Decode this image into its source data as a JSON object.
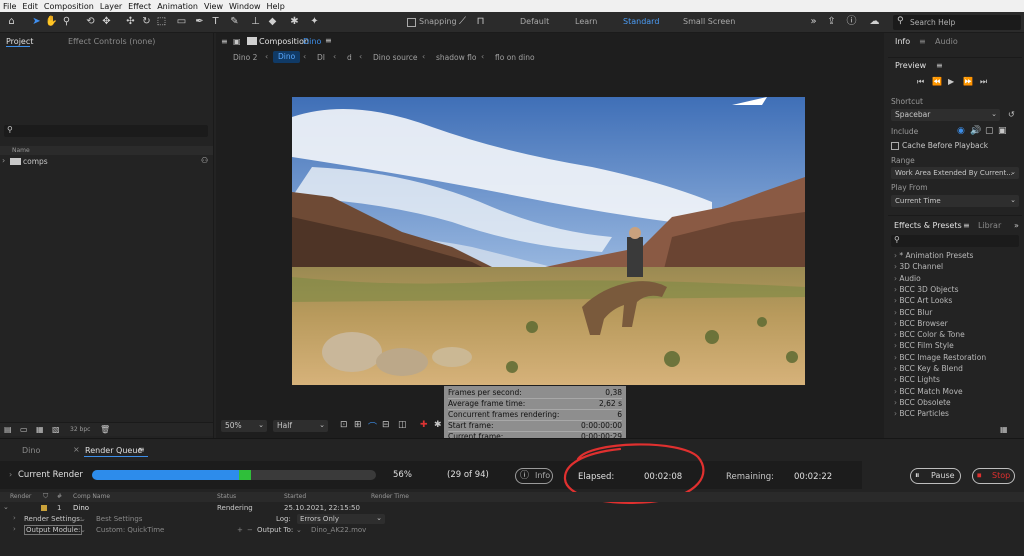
{
  "menu": [
    "File",
    "Edit",
    "Composition",
    "Layer",
    "Effect",
    "Animation",
    "View",
    "Window",
    "Help"
  ],
  "toolbar": {
    "snapping": "Snapping",
    "workspaces": [
      "Default",
      "Learn",
      "Standard",
      "Small Screen"
    ],
    "search_placeholder": "Search Help"
  },
  "left": {
    "tab_project": "Project",
    "tab_effect_controls": "Effect Controls (none)",
    "col_name": "Name",
    "folder": "comps",
    "bpc": "32 bpc"
  },
  "comp": {
    "tab_label": "Composition",
    "comp_name": "Dino",
    "crumbs": [
      "Dino 2",
      "Dino",
      "DI",
      "d",
      "Dino source",
      "shadow flo",
      "flo on dino"
    ],
    "zoom": "50%",
    "resolution": "Half"
  },
  "info": {
    "tab_info": "Info",
    "tab_audio": "Audio",
    "preview": "Preview",
    "shortcut_label": "Shortcut",
    "shortcut": "Spacebar",
    "include": "Include",
    "cache": "Cache Before Playback",
    "range_label": "Range",
    "range": "Work Area Extended By Current...",
    "playfrom_label": "Play From",
    "playfrom": "Current Time"
  },
  "effects": {
    "tab": "Effects & Presets",
    "tab_library": "Librar",
    "items": [
      "* Animation Presets",
      "3D Channel",
      "Audio",
      "BCC 3D Objects",
      "BCC Art Looks",
      "BCC Blur",
      "BCC Browser",
      "BCC Color & Tone",
      "BCC Film Style",
      "BCC Image Restoration",
      "BCC Key & Blend",
      "BCC Lights",
      "BCC Match Move",
      "BCC Obsolete",
      "BCC Particles"
    ]
  },
  "overlay": {
    "rows": [
      [
        "Frames per second:",
        "0,38"
      ],
      [
        "Average frame time:",
        "2,62 s"
      ],
      [
        "Concurrent frames rendering:",
        "6"
      ],
      [
        "Start frame:",
        "0:00:00:00"
      ],
      [
        "Current frame:",
        "0:00:00:29"
      ],
      [
        "End frame:",
        "0:00:03:03"
      ]
    ]
  },
  "render": {
    "tab_dino": "Dino",
    "tab_rq": "Render Queue",
    "current_render": "Current Render",
    "percent": "56%",
    "progress": 0.56,
    "frames": "(29 of 94)",
    "info_btn": "Info",
    "elapsed_label": "Elapsed:",
    "elapsed": "00:02:08",
    "remaining_label": "Remaining:",
    "remaining": "00:02:22",
    "pause": "Pause",
    "stop": "Stop",
    "headers": [
      "Render",
      "#",
      "Comp Name",
      "Status",
      "Started",
      "Render Time"
    ],
    "row": {
      "num": "1",
      "comp": "Dino",
      "status": "Rendering",
      "started": "25.10.2021, 22:15:50"
    },
    "render_settings_label": "Render Settings:",
    "render_settings": "Best Settings",
    "log_label": "Log:",
    "log": "Errors Only",
    "output_module_label": "Output Module:",
    "output_module": "Custom: QuickTime",
    "output_to_label": "Output To:",
    "output_to": "Dino_AK22.mov"
  },
  "colors": {
    "accent": "#2d8ceb",
    "green": "#2fbf3a",
    "annotation": "#e0302f"
  }
}
